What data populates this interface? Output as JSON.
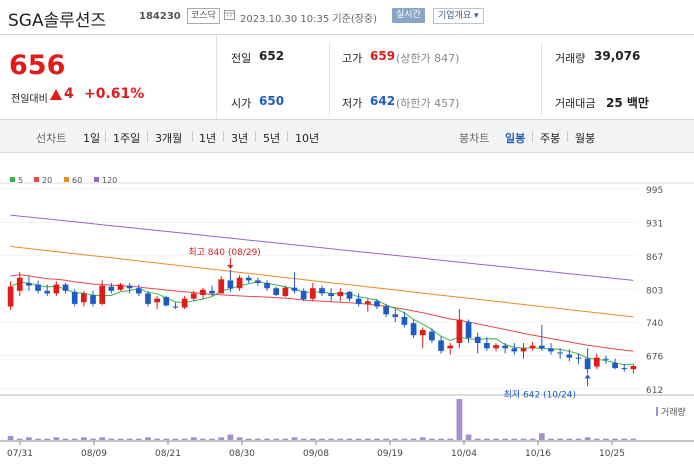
{
  "header": {
    "name": "SGA솔루션즈",
    "code": "184230",
    "market": "코스닥",
    "timestamp": "2023.10.30 10:35 기준(장중)",
    "realtime": "실시간",
    "company": "기업개요 ▾"
  },
  "price": {
    "current": "656",
    "compare_label": "전일대비",
    "change": "4",
    "change_rate": "+0.61%",
    "up_color": "#e21a1a",
    "down_color": "#1e5bc6"
  },
  "quotes": {
    "prev_label": "전일",
    "prev_value": "652",
    "high_label": "고가",
    "high_value": "659",
    "high_sub": "(상한가 847)",
    "volume_label": "거래량",
    "volume_value": "39,076",
    "open_label": "시가",
    "open_value": "650",
    "low_label": "저가",
    "low_value": "642",
    "low_sub": "(하한가 457)",
    "amount_label": "거래대금",
    "amount_value": "25 백만"
  },
  "periods": {
    "line_label": "선차트",
    "line_options": [
      "1일",
      "1주일",
      "3개월",
      "1년",
      "3년",
      "5년",
      "10년"
    ],
    "candle_label": "봉차트",
    "candle_options": [
      "일봉",
      "주봉",
      "월봉"
    ],
    "active_candle": "일봉"
  },
  "chart_data": {
    "type": "candlestick",
    "legend": [
      {
        "name": "5",
        "color": "#3ab54a"
      },
      {
        "name": "20",
        "color": "#e84a4a"
      },
      {
        "name": "60",
        "color": "#f08c1e"
      },
      {
        "name": "120",
        "color": "#9966cc"
      }
    ],
    "y_ticks": [
      995,
      931,
      867,
      803,
      740,
      676,
      612
    ],
    "ylim": [
      612,
      995
    ],
    "x_labels": [
      "07/31",
      "08/09",
      "08/21",
      "08/30",
      "09/08",
      "09/19",
      "10/04",
      "10/16",
      "10/25"
    ],
    "annotation_high": "최고 840 (08/29)",
    "annotation_low": "최저 642 (10/24)",
    "volume_label": "거래량",
    "candles": [
      [
        770,
        818,
        763,
        808
      ],
      [
        800,
        836,
        790,
        825
      ],
      [
        815,
        828,
        800,
        810
      ],
      [
        812,
        820,
        795,
        800
      ],
      [
        800,
        812,
        790,
        795
      ],
      [
        795,
        818,
        790,
        812
      ],
      [
        812,
        815,
        795,
        800
      ],
      [
        798,
        803,
        770,
        775
      ],
      [
        778,
        800,
        770,
        795
      ],
      [
        792,
        800,
        770,
        775
      ],
      [
        775,
        820,
        772,
        810
      ],
      [
        808,
        815,
        795,
        800
      ],
      [
        802,
        815,
        800,
        812
      ],
      [
        810,
        815,
        795,
        805
      ],
      [
        805,
        812,
        790,
        795
      ],
      [
        795,
        800,
        770,
        775
      ],
      [
        778,
        790,
        765,
        785
      ],
      [
        788,
        790,
        770,
        772
      ],
      [
        770,
        778,
        765,
        768
      ],
      [
        768,
        790,
        765,
        785
      ],
      [
        785,
        800,
        780,
        795
      ],
      [
        792,
        805,
        785,
        802
      ],
      [
        800,
        810,
        790,
        795
      ],
      [
        795,
        828,
        795,
        822
      ],
      [
        820,
        840,
        798,
        805
      ],
      [
        805,
        830,
        800,
        825
      ],
      [
        825,
        830,
        815,
        820
      ],
      [
        820,
        825,
        810,
        815
      ],
      [
        815,
        820,
        800,
        805
      ],
      [
        805,
        808,
        790,
        792
      ],
      [
        790,
        810,
        788,
        806
      ],
      [
        806,
        836,
        795,
        800
      ],
      [
        800,
        805,
        780,
        784
      ],
      [
        785,
        815,
        780,
        805
      ],
      [
        805,
        810,
        790,
        795
      ],
      [
        795,
        805,
        780,
        790
      ],
      [
        790,
        805,
        780,
        798
      ],
      [
        798,
        800,
        780,
        785
      ],
      [
        785,
        795,
        770,
        775
      ],
      [
        775,
        785,
        760,
        780
      ],
      [
        780,
        785,
        765,
        770
      ],
      [
        770,
        775,
        750,
        755
      ],
      [
        755,
        765,
        740,
        750
      ],
      [
        750,
        760,
        730,
        735
      ],
      [
        738,
        745,
        710,
        715
      ],
      [
        715,
        730,
        690,
        725
      ],
      [
        722,
        728,
        700,
        705
      ],
      [
        705,
        712,
        680,
        685
      ],
      [
        690,
        700,
        678,
        695
      ],
      [
        700,
        765,
        690,
        745
      ],
      [
        740,
        745,
        700,
        710
      ],
      [
        712,
        720,
        680,
        700
      ],
      [
        700,
        712,
        685,
        690
      ],
      [
        690,
        700,
        684,
        696
      ],
      [
        695,
        700,
        680,
        690
      ],
      [
        690,
        700,
        678,
        684
      ],
      [
        684,
        700,
        670,
        690
      ],
      [
        690,
        702,
        685,
        695
      ],
      [
        695,
        735,
        685,
        690
      ],
      [
        690,
        700,
        678,
        684
      ],
      [
        682,
        690,
        670,
        680
      ],
      [
        678,
        688,
        665,
        672
      ],
      [
        672,
        680,
        660,
        670
      ],
      [
        670,
        690,
        642,
        650
      ],
      [
        655,
        680,
        650,
        672
      ],
      [
        670,
        676,
        660,
        668
      ],
      [
        662,
        670,
        650,
        652
      ],
      [
        652,
        660,
        645,
        650
      ],
      [
        650,
        659,
        642,
        656
      ]
    ],
    "volumes": [
      3,
      1,
      2,
      1,
      1,
      2,
      1,
      1,
      2,
      1,
      2,
      1,
      1,
      1,
      1,
      2,
      1,
      1,
      1,
      1,
      2,
      1,
      1,
      2,
      4,
      2,
      1,
      1,
      1,
      1,
      1,
      2,
      1,
      1,
      1,
      1,
      1,
      1,
      1,
      1,
      1,
      1,
      1,
      1,
      1,
      2,
      1,
      1,
      1,
      30,
      4,
      1,
      1,
      1,
      1,
      1,
      1,
      1,
      5,
      1,
      1,
      1,
      1,
      2,
      1,
      1,
      1,
      1,
      1
    ]
  }
}
